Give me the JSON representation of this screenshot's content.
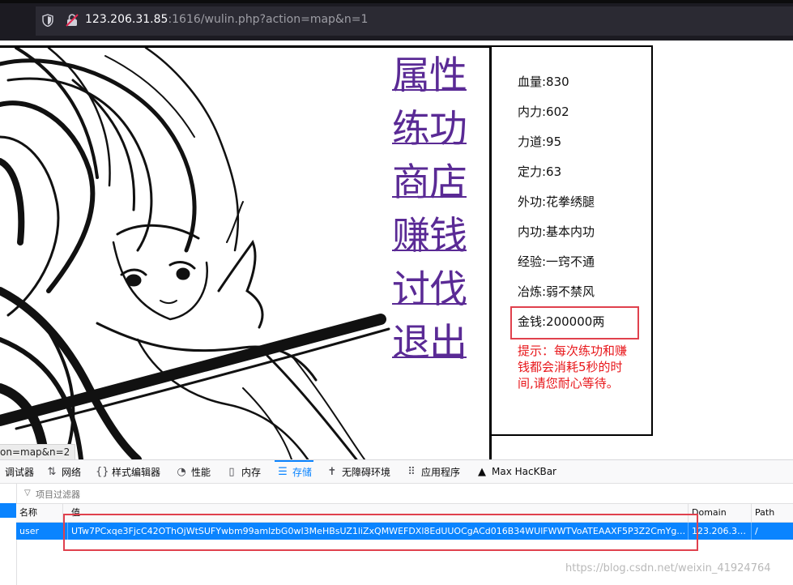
{
  "browser": {
    "url_host": "123.206.31.85",
    "url_rest": ":1616/wulin.php?action=map&n=1",
    "icons": [
      "shield-icon",
      "insecure-lock-icon"
    ]
  },
  "menu": [
    {
      "label": "属性"
    },
    {
      "label": "练功"
    },
    {
      "label": "商店"
    },
    {
      "label": "赚钱"
    },
    {
      "label": "讨伐"
    },
    {
      "label": "退出"
    }
  ],
  "stats": [
    {
      "label": "血量:830"
    },
    {
      "label": "内力:602"
    },
    {
      "label": "力道:95"
    },
    {
      "label": "定力:63"
    },
    {
      "label": "外功:花拳绣腿"
    },
    {
      "label": "内功:基本内功"
    },
    {
      "label": "经验:一窍不通"
    },
    {
      "label": "冶炼:弱不禁风"
    },
    {
      "label": "金钱:200000两"
    }
  ],
  "tip": "提示：每次练功和赚钱都会消耗5秒的时间,请您耐心等待。",
  "status_url": "on=map&n=2",
  "devtools": {
    "tabs": [
      {
        "label": "调试器",
        "icon": "debugger-icon"
      },
      {
        "label": "网络",
        "icon": "network-icon"
      },
      {
        "label": "样式编辑器",
        "icon": "style-editor-icon"
      },
      {
        "label": "性能",
        "icon": "performance-icon"
      },
      {
        "label": "内存",
        "icon": "memory-icon"
      },
      {
        "label": "存储",
        "icon": "storage-icon",
        "active": true
      },
      {
        "label": "无障碍环境",
        "icon": "accessibility-icon"
      },
      {
        "label": "应用程序",
        "icon": "application-icon"
      },
      {
        "label": "Max HacKBar",
        "icon": "hackbar-icon"
      }
    ],
    "filter_placeholder": "项目过滤器",
    "columns": [
      "名称",
      "值",
      "Domain",
      "Path"
    ],
    "rows": [
      {
        "name": "user",
        "value": "UTw7PCxqe3FjcC42OThOjWtSUFYwbm99amlzbG0wI3MeHBsUZ1liZxQMWEFDXl8EdUUOCgACd016B34WUlFWWTVoATEAAXF5P3Z2CmYgPT...",
        "domain": "123.206.31....",
        "path": "/"
      }
    ]
  },
  "watermark": "https://blog.csdn.net/weixin_41924764",
  "colors": {
    "link": "#5a2a95",
    "highlight_box": "#e0414d",
    "tip": "#e8171b",
    "devtools_accent": "#0a84ff"
  }
}
